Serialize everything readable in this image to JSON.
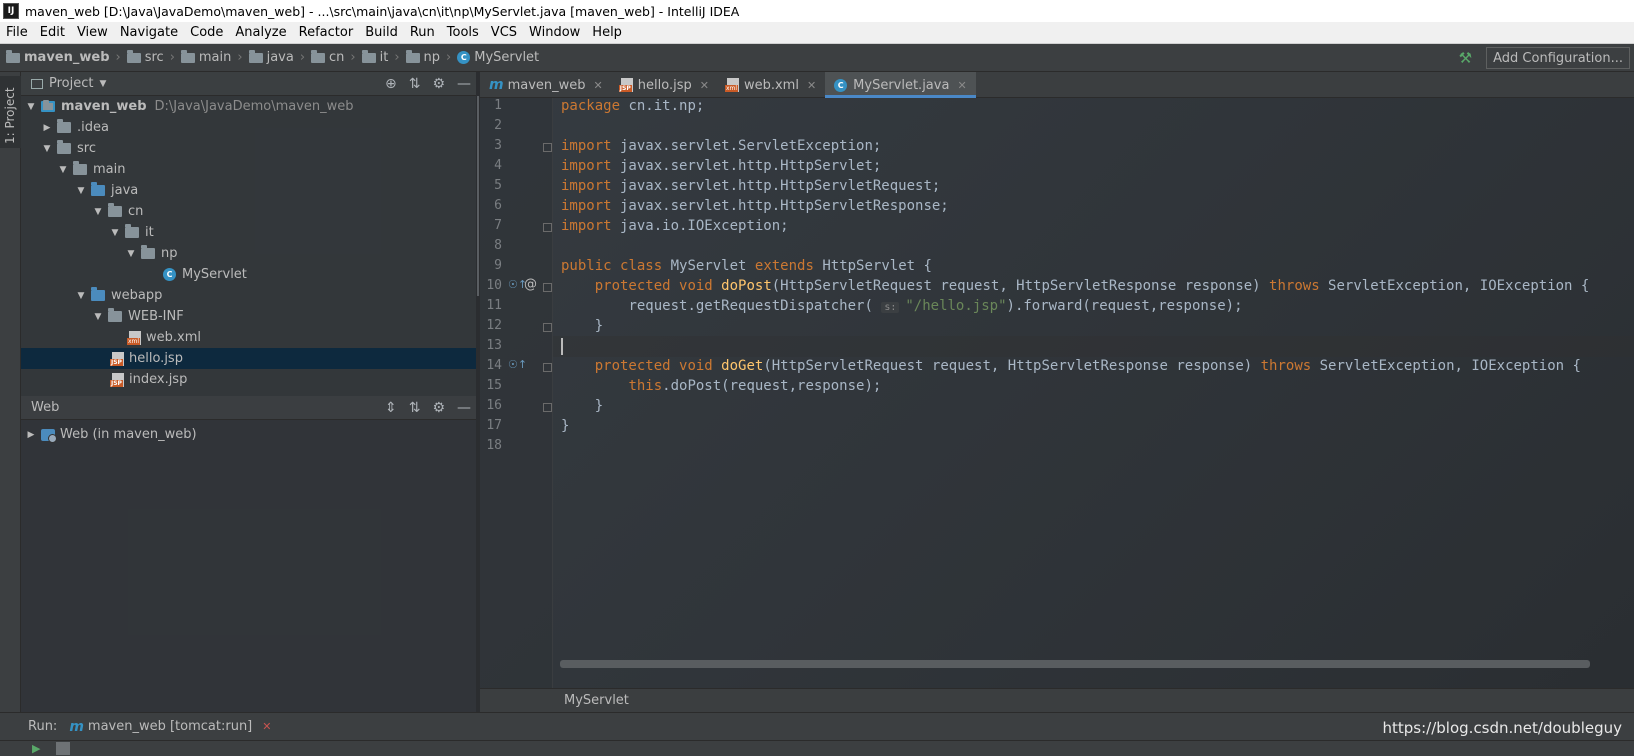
{
  "window": {
    "title": "maven_web [D:\\Java\\JavaDemo\\maven_web] - ...\\src\\main\\java\\cn\\it\\np\\MyServlet.java [maven_web] - IntelliJ IDEA",
    "app_icon": "IJ"
  },
  "menu": [
    "File",
    "Edit",
    "View",
    "Navigate",
    "Code",
    "Analyze",
    "Refactor",
    "Build",
    "Run",
    "Tools",
    "VCS",
    "Window",
    "Help"
  ],
  "breadcrumb": {
    "items": [
      "maven_web",
      "src",
      "main",
      "java",
      "cn",
      "it",
      "np",
      "MyServlet"
    ],
    "add_configuration": "Add Configuration..."
  },
  "left_stripe": {
    "project_tab": "1: Project"
  },
  "project_panel": {
    "title": "Project",
    "tree": [
      {
        "label": "maven_web",
        "path": "D:\\Java\\JavaDemo\\maven_web"
      },
      {
        "label": ".idea"
      },
      {
        "label": "src"
      },
      {
        "label": "main"
      },
      {
        "label": "java"
      },
      {
        "label": "cn"
      },
      {
        "label": "it"
      },
      {
        "label": "np"
      },
      {
        "label": "MyServlet"
      },
      {
        "label": "webapp"
      },
      {
        "label": "WEB-INF"
      },
      {
        "label": "web.xml"
      },
      {
        "label": "hello.jsp"
      },
      {
        "label": "index.jsp"
      }
    ]
  },
  "web_panel": {
    "title": "Web",
    "items": [
      "Web (in maven_web)"
    ]
  },
  "editor_tabs": [
    {
      "label": "maven_web"
    },
    {
      "label": "hello.jsp"
    },
    {
      "label": "web.xml"
    },
    {
      "label": "MyServlet.java",
      "active": true
    }
  ],
  "editor": {
    "line_numbers": [
      "1",
      "2",
      "3",
      "4",
      "5",
      "6",
      "7",
      "8",
      "9",
      "10",
      "11",
      "12",
      "13",
      "14",
      "15",
      "16",
      "17",
      "18"
    ],
    "code": {
      "l1_kw": "package",
      "l1_rest": " cn.it.np;",
      "import_kw": "import",
      "l3": " javax.servlet.ServletException;",
      "l4": " javax.servlet.http.HttpServlet;",
      "l5": " javax.servlet.http.HttpServletRequest;",
      "l6": " javax.servlet.http.HttpServletResponse;",
      "l7": " java.io.IOException;",
      "l9_public": "public",
      "l9_class": "class",
      "l9_name": " MyServlet ",
      "l9_extends": "extends",
      "l9_rest": " HttpServlet {",
      "protected": "protected",
      "void": "void",
      "throws": "throws",
      "l10_fn": "doPost",
      "l10_params": "(HttpServletRequest request, HttpServletResponse response) ",
      "l10_exc": " ServletException, IOException {",
      "l11_a": "request.getRequestDispatcher(",
      "l11_hint": "s:",
      "l11_str": "\"/hello.jsp\"",
      "l11_b": ").forward(request,response);",
      "close_brace": "}",
      "l14_fn": "doGet",
      "l14_params": "(HttpServletRequest request, HttpServletResponse response) ",
      "l14_exc": " ServletException, IOException {",
      "l15_this": "this",
      "l15_rest": ".doPost(request,response);"
    }
  },
  "editor_breadcrumb": "MyServlet",
  "run_bar": {
    "label": "Run:",
    "config": "maven_web [tomcat:run]"
  },
  "watermark": "https://blog.csdn.net/doubleguy",
  "colors": {
    "keyword": "#cc7832",
    "method": "#ffc66d",
    "string": "#6a8759",
    "accent": "#4a88c7"
  }
}
